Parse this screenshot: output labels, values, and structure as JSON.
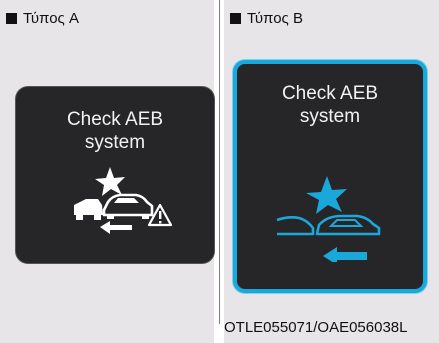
{
  "panel_a": {
    "type_label": "Τύπος A",
    "message_line1": "Check AEB",
    "message_line2": "system"
  },
  "panel_b": {
    "type_label": "Τύπος B",
    "message_line1": "Check AEB",
    "message_line2": "system"
  },
  "figure_code": "OTLE055071/OAE056038L",
  "colors": {
    "display_background": "#262628",
    "icon_white": "#ffffff",
    "icon_blue": "#1aa7d9"
  },
  "icons": {
    "panel_a": "aeb-collision-warning-icon",
    "panel_b": "aeb-collision-warning-icon"
  }
}
